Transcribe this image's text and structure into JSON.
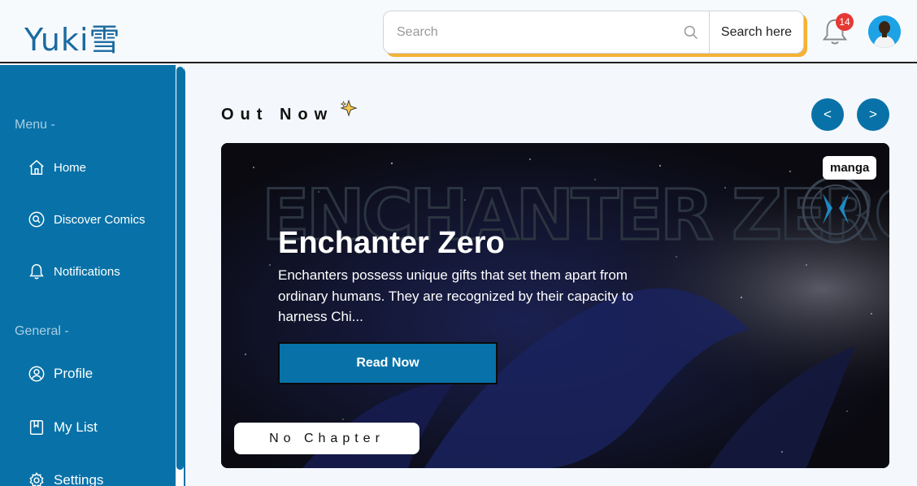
{
  "header": {
    "logo": "Yuki雪",
    "search": {
      "placeholder": "Search",
      "button_label": "Search here"
    },
    "notifications": {
      "count": "14"
    }
  },
  "sidebar": {
    "menu_label": "Menu -",
    "general_label": "General -",
    "menu_items": [
      {
        "label": "Home",
        "icon": "home-icon"
      },
      {
        "label": "Discover Comics",
        "icon": "discover-icon"
      },
      {
        "label": "Notifications",
        "icon": "bell-icon"
      }
    ],
    "general_items": [
      {
        "label": "Profile",
        "icon": "profile-icon"
      },
      {
        "label": "My List",
        "icon": "list-icon"
      },
      {
        "label": "Settings",
        "icon": "settings-icon"
      }
    ]
  },
  "main": {
    "section_title": "Out Now",
    "prev_label": "<",
    "next_label": ">",
    "featured": {
      "tag": "manga",
      "logo_text": "ENCHANTER ZERO",
      "title": "Enchanter Zero",
      "description": "Enchanters possess unique gifts that set them apart from ordinary humans. They are recognized by their capacity to harness Chi...",
      "read_button": "Read Now",
      "chapter_label": "No Chapter"
    }
  },
  "colors": {
    "brand": "#0872a8",
    "accent": "#f5b236",
    "badge": "#e53935",
    "logo": "#1a6aa0"
  }
}
